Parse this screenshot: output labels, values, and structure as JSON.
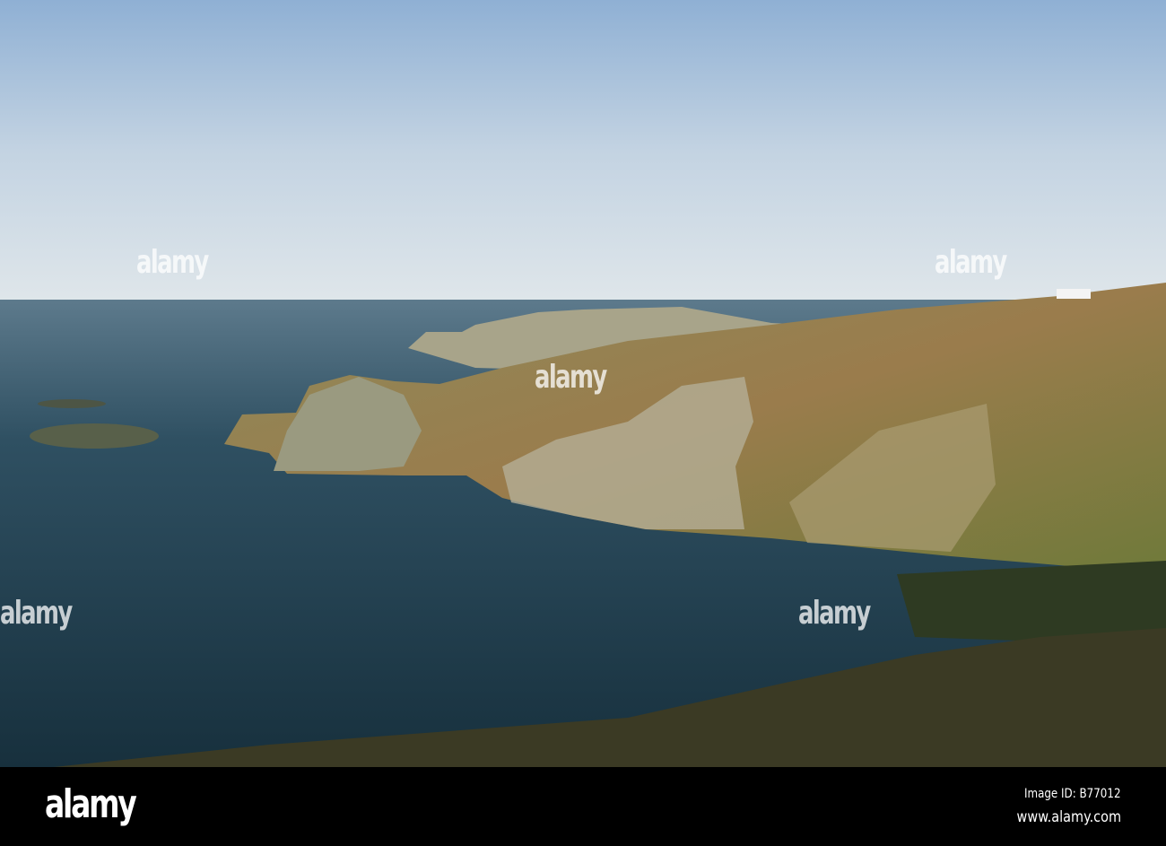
{
  "photo": {
    "subject": "coastal cliffs and sea",
    "colors": {
      "sky_top": "#8fb0d4",
      "sky_bottom": "#d9e3ea",
      "sea": "#1f3c4c",
      "cliff": "#8a8a5a",
      "heath": "#9a7a4a",
      "foreground": "#3a3a22"
    }
  },
  "watermark": {
    "text": "alamy"
  },
  "footer": {
    "logo": "alamy",
    "image_id": "Image ID: B77012",
    "website": "www.alamy.com"
  }
}
